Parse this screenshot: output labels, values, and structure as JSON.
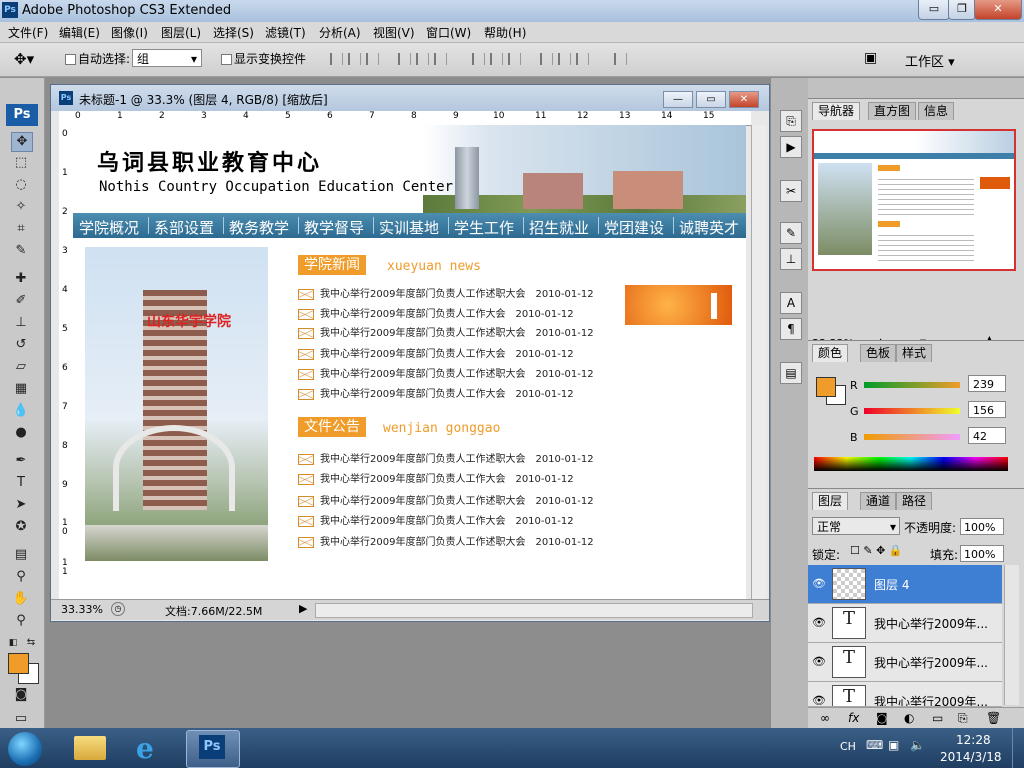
{
  "app": {
    "title": "Adobe Photoshop CS3 Extended",
    "logo": "Ps"
  },
  "window_buttons": {
    "minimize": "▭",
    "restore": "❐",
    "close": "✕"
  },
  "menu": [
    "文件(F)",
    "编辑(E)",
    "图像(I)",
    "图层(L)",
    "选择(S)",
    "滤镜(T)",
    "分析(A)",
    "视图(V)",
    "窗口(W)",
    "帮助(H)"
  ],
  "options": {
    "auto_select_label": "自动选择:",
    "auto_select_value": "组",
    "show_transform_label": "显示变换控件",
    "workspace_label": "工作区 ▾"
  },
  "document": {
    "title": "未标题-1 @ 33.3% (图层 4, RGB/8) [缩放后]",
    "zoom": "33.33%",
    "doc_size": "文档:7.66M/22.5M",
    "ruler_top": [
      "0",
      "1",
      "2",
      "3",
      "4",
      "5",
      "6",
      "7",
      "8",
      "9",
      "10",
      "11",
      "12",
      "13",
      "14",
      "15"
    ],
    "ruler_left": [
      "0",
      "1",
      "2",
      "3",
      "4",
      "5",
      "6",
      "7",
      "8",
      "9",
      "1\n0",
      "1\n1"
    ]
  },
  "site": {
    "title": "乌词县职业教育中心",
    "subtitle": "Nothis Country Occupation Education Center",
    "nav": [
      "学院概况",
      "系部设置",
      "教务教学",
      "教学督导",
      "实训基地",
      "学生工作",
      "招生就业",
      "党团建设",
      "诚聘英才"
    ],
    "photo_sign": "山东华宇学院",
    "news": {
      "tag": "学院新闻",
      "en": "xueyuan news",
      "items": [
        {
          "text": "我中心举行2009年度部门负责人工作述职大会",
          "date": "2010-01-12"
        },
        {
          "text": "我中心举行2009年度部门负责人工作大会",
          "date": "2010-01-12"
        },
        {
          "text": "我中心举行2009年度部门负责人工作述职大会",
          "date": "2010-01-12"
        },
        {
          "text": "我中心举行2009年度部门负责人工作大会",
          "date": "2010-01-12"
        },
        {
          "text": "我中心举行2009年度部门负责人工作述职大会",
          "date": "2010-01-12"
        },
        {
          "text": "我中心举行2009年度部门负责人工作大会",
          "date": "2010-01-12"
        }
      ]
    },
    "notice": {
      "tag": "文件公告",
      "en": "wenjian gonggao",
      "items": [
        {
          "text": "我中心举行2009年度部门负责人工作述职大会",
          "date": "2010-01-12"
        },
        {
          "text": "我中心举行2009年度部门负责人工作大会",
          "date": "2010-01-12"
        },
        {
          "text": "我中心举行2009年度部门负责人工作述职大会",
          "date": "2010-01-12"
        },
        {
          "text": "我中心举行2009年度部门负责人工作大会",
          "date": "2010-01-12"
        },
        {
          "text": "我中心举行2009年度部门负责人工作述职大会",
          "date": "2010-01-12"
        }
      ]
    }
  },
  "navigator": {
    "tabs": [
      "导航器",
      "直方图",
      "信息"
    ],
    "zoom": "33.33%"
  },
  "color_panel": {
    "tabs": [
      "颜色",
      "色板",
      "样式"
    ],
    "r_label": "R",
    "g_label": "G",
    "b_label": "B",
    "r": "239",
    "g": "156",
    "b": "42",
    "fg": "#ef9c2a"
  },
  "layers_panel": {
    "tabs": [
      "图层",
      "通道",
      "路径"
    ],
    "blend": "正常",
    "opacity_label": "不透明度:",
    "opacity": "100%",
    "lock_label": "锁定:",
    "fill_label": "填充:",
    "fill": "100%",
    "layers": [
      {
        "name": "图层 4",
        "thumb": "",
        "selected": true
      },
      {
        "name": "我中心举行2009年...",
        "thumb": "T",
        "selected": false
      },
      {
        "name": "我中心举行2009年...",
        "thumb": "T",
        "selected": false
      },
      {
        "name": "我中心举行2009年...",
        "thumb": "T",
        "selected": false
      }
    ]
  },
  "taskbar": {
    "lang": "CH",
    "time": "12:28",
    "date": "2014/3/18",
    "ps_label": "Ps"
  }
}
